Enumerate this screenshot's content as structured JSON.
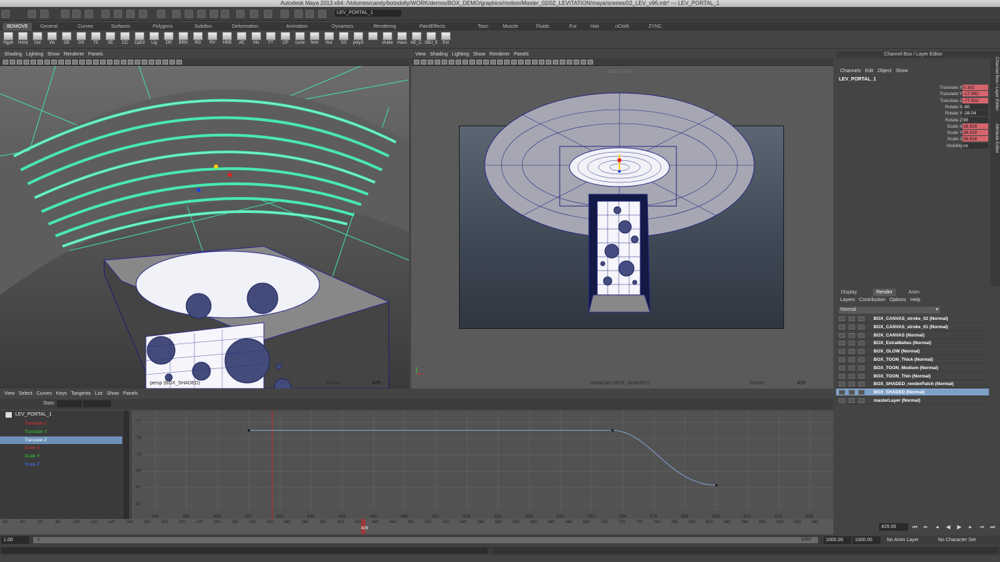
{
  "window": {
    "title": "Autodesk Maya 2013 x64: /Volumes/candy/botndolly/WORK/demos/BOX_DEMO/graphics/motion/Master_02/02_LEVITATION/maya/scenes/02_LEV_v96.mb*  ---   LEV_PORTAL_1"
  },
  "status_line": {
    "selection_field": "LEV_PORTAL_1"
  },
  "shelf": {
    "tabs": [
      "BDMOVE",
      "General",
      "Curves",
      "Surfaces",
      "Polygons",
      "Subdivs",
      "Deformation",
      "Animation",
      "Dynamics",
      "Rendering",
      "PaintEffects",
      "Toon",
      "Muscle",
      "Fluids",
      "Fur",
      "Hair",
      "nCloth",
      "ZYNC"
    ],
    "active_tab": "BDMOVE",
    "items": [
      "Hgph",
      "Hshd",
      "Out",
      "Vis",
      "GE",
      "DS",
      "TE",
      "SE",
      "CC",
      "CpEd",
      "Lig",
      "DR",
      "BRN",
      "RG",
      "RV",
      "HRB",
      "AE",
      "Hls",
      "FT",
      "CP",
      "curre",
      "Nrm",
      "Nor",
      "SS",
      "polyS",
      "",
      "shake",
      "mass",
      "AE_C.",
      "OBJ_E",
      "Ext"
    ]
  },
  "viewport_left": {
    "menu": [
      "Shading",
      "Lighting",
      "Show",
      "Renderer",
      "Panels"
    ],
    "camera_label": "persp (BOX_SHADED)",
    "frame_label": "Frame:",
    "frame_value": "429"
  },
  "viewport_right": {
    "menu": [
      "View",
      "Shading",
      "Lighting",
      "Show",
      "Renderer",
      "Panels"
    ],
    "resolution": "1920 x 1200",
    "camera_label": "robotCam (BOX_SHADED)",
    "frame_label": "Frame:",
    "frame_value": "429"
  },
  "channel_box": {
    "title": "Channel Box / Layer Editor",
    "menu": [
      "Channels",
      "Edit",
      "Object",
      "Show"
    ],
    "object": "LEV_PORTAL_1",
    "channels": [
      {
        "name": "Translate X",
        "value": "0.162",
        "keyed": true
      },
      {
        "name": "Translate Y",
        "value": "-17.992",
        "keyed": true
      },
      {
        "name": "Translate Z",
        "value": "-77.502",
        "keyed": true
      },
      {
        "name": "Rotate X",
        "value": "-90",
        "keyed": false
      },
      {
        "name": "Rotate Y",
        "value": "-28.04",
        "keyed": false
      },
      {
        "name": "Rotate Z",
        "value": "90",
        "keyed": false
      },
      {
        "name": "Scale X",
        "value": "36.918",
        "keyed": true
      },
      {
        "name": "Scale Y",
        "value": "36.918",
        "keyed": true
      },
      {
        "name": "Scale Z",
        "value": "36.918",
        "keyed": true
      },
      {
        "name": "Visibility",
        "value": "on",
        "keyed": false
      }
    ],
    "side_tabs": [
      "Channel Box / Layer Editor",
      "Attribute Editor"
    ]
  },
  "layer_editor": {
    "tabs": [
      "Display",
      "Render",
      "Anim"
    ],
    "active_tab": "Render",
    "menu": [
      "Layers",
      "Contribution",
      "Options",
      "Help"
    ],
    "blend_mode": "Normal",
    "layers": [
      {
        "name": "BOX_CANVAS_stroke_02 (Normal)",
        "selected": false
      },
      {
        "name": "BOX_CANVAS_stroke_01 (Normal)",
        "selected": false
      },
      {
        "name": "BOX_CANVAS (Normal)",
        "selected": false
      },
      {
        "name": "BOX_ExtraMattes (Normal)",
        "selected": false
      },
      {
        "name": "BOX_GLOW (Normal)",
        "selected": false
      },
      {
        "name": "BOX_TOON_Thick (Normal)",
        "selected": false
      },
      {
        "name": "BOX_TOON_Medium (Normal)",
        "selected": false
      },
      {
        "name": "BOX_TOON_Thin (Normal)",
        "selected": false
      },
      {
        "name": "BOX_SHADED_renderPatch (Normal)",
        "selected": false
      },
      {
        "name": "BOX_SHADED (Normal)",
        "selected": true
      },
      {
        "name": "masterLayer (Normal)",
        "selected": false
      }
    ]
  },
  "graph_editor": {
    "menu": [
      "View",
      "Select",
      "Curves",
      "Keys",
      "Tangents",
      "List",
      "Show",
      "Panels"
    ],
    "stats_label": "Stats",
    "outliner": {
      "object": "LEV_PORTAL_1",
      "attributes": [
        {
          "name": "Translate X",
          "color": "#e03030",
          "selected": false
        },
        {
          "name": "Translate Y",
          "color": "#30d030",
          "selected": false
        },
        {
          "name": "Translate Z",
          "color": "#ffffff",
          "selected": true
        },
        {
          "name": "Scale X",
          "color": "#e03030",
          "selected": false
        },
        {
          "name": "Scale Y",
          "color": "#30d030",
          "selected": false
        },
        {
          "name": "Scale Z",
          "color": "#4070ff",
          "selected": false
        }
      ]
    },
    "y_ticks": [
      "-77",
      "-78",
      "-79",
      "-80",
      "-81",
      "-82"
    ],
    "x_ticks": [
      "384",
      "396",
      "408",
      "420",
      "432",
      "444",
      "456",
      "468",
      "480",
      "492",
      "504",
      "516",
      "528",
      "540",
      "552",
      "564",
      "576",
      "588",
      "600",
      "612",
      "624",
      "636"
    ],
    "current_frame_marker": "429",
    "curve": {
      "attribute": "Translate Z",
      "color": "#7d99c4",
      "keys": [
        {
          "frame": 420,
          "value": -77.5
        },
        {
          "frame": 560,
          "value": -77.5
        },
        {
          "frame": 600,
          "value": -80.85
        }
      ]
    }
  },
  "time_slider": {
    "ticks": [
      "30",
      "40",
      "60",
      "80",
      "100",
      "120",
      "140",
      "160",
      "180",
      "200",
      "220",
      "240",
      "260",
      "280",
      "300",
      "320",
      "340",
      "360",
      "380",
      "400",
      "420",
      "440",
      "460",
      "480",
      "500",
      "520",
      "540",
      "560",
      "580",
      "600",
      "620",
      "640",
      "660",
      "680",
      "700",
      "720",
      "740",
      "760",
      "780",
      "800",
      "820",
      "840",
      "860",
      "880",
      "900",
      "920",
      "940"
    ],
    "current_frame": "429",
    "current_field": "429.00"
  },
  "range_slider": {
    "start": "1.00",
    "range_start": "1",
    "range_end": "1000",
    "end_a": "1000.00",
    "end_b": "1000.00",
    "anim_layer": "No Anim Layer",
    "character_set": "No Character Set"
  },
  "colors": {
    "accent": "#7ea1c8",
    "keyed": "#d6656e",
    "wire": "#3ad9a0",
    "time_marker": "#cc2020"
  }
}
